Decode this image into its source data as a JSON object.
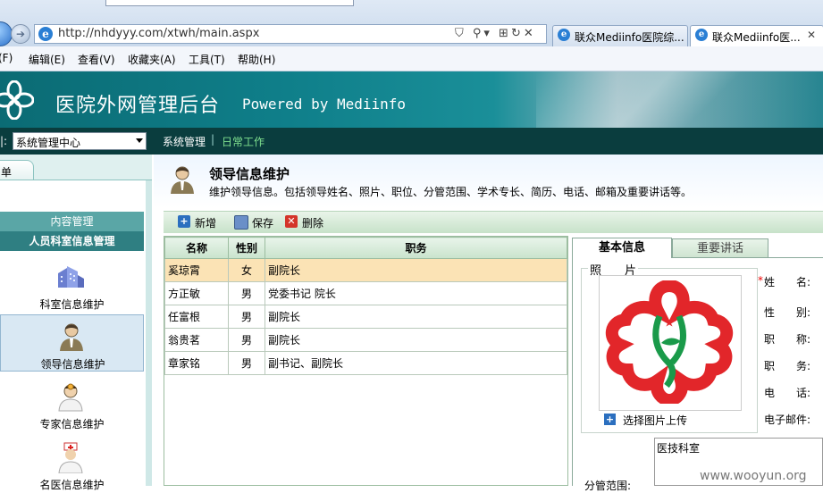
{
  "browser": {
    "address": "http://nhdyyy.com/xtwh/main.aspx",
    "tabs": [
      {
        "label": "联众Mediinfo医院综..."
      },
      {
        "label": "联众Mediinfo医..."
      }
    ]
  },
  "menubar": {
    "items": [
      "(F)",
      "编辑(E)",
      "查看(V)",
      "收藏夹(A)",
      "工具(T)",
      "帮助(H)"
    ]
  },
  "banner": {
    "title": "医院外网管理后台",
    "powered": "Powered by Mediinfo"
  },
  "nav": {
    "label": "|:",
    "system_select": "系统管理中心",
    "system_link": "系统管理",
    "separator": "|",
    "daily_link": "日常工作"
  },
  "sidebar": {
    "tab_label": "单",
    "content_header": "内容管理",
    "staff_header": "人员科室信息管理",
    "items": [
      {
        "label": "科室信息维护",
        "icon": "department-building-icon"
      },
      {
        "label": "领导信息维护",
        "icon": "leader-person-icon"
      },
      {
        "label": "专家信息维护",
        "icon": "expert-doctor-icon"
      },
      {
        "label": "名医信息维护",
        "icon": "famous-doctor-icon"
      }
    ]
  },
  "page": {
    "title": "领导信息维护",
    "description": "维护领导信息。包括领导姓名、照片、职位、分管范围、学术专长、简历、电话、邮箱及重要讲话等。"
  },
  "toolbar": {
    "add": "新增",
    "save": "保存",
    "delete": "删除"
  },
  "grid": {
    "columns": [
      "名称",
      "性别",
      "职务"
    ],
    "rows": [
      {
        "name": "奚琼霄",
        "gender": "女",
        "title": "副院长"
      },
      {
        "name": "方正敏",
        "gender": "男",
        "title": "党委书记 院长"
      },
      {
        "name": "任富根",
        "gender": "男",
        "title": "副院长"
      },
      {
        "name": "翁贵茗",
        "gender": "男",
        "title": "副院长"
      },
      {
        "name": "章家铭",
        "gender": "男",
        "title": "副书记、副院长"
      }
    ]
  },
  "detail": {
    "tab_basic": "基本信息",
    "tab_speech": "重要讲话",
    "photo_legend": "照　　片",
    "upload_label": "选择图片上传",
    "fields": [
      "姓　　名:",
      "性　　别:",
      "职　　称:",
      "职　　务:",
      "电　　话:",
      "电子邮件:"
    ],
    "required_mark": "*",
    "dept_value": "医技科室",
    "range_label": "分管范围:"
  },
  "watermark": "www.wooyun.org",
  "colors": {
    "banner": "#0f7f8a",
    "nav_strip": "#0a3d3e",
    "selected_row": "#fbe3b5",
    "daily_link": "#7fe08f"
  }
}
